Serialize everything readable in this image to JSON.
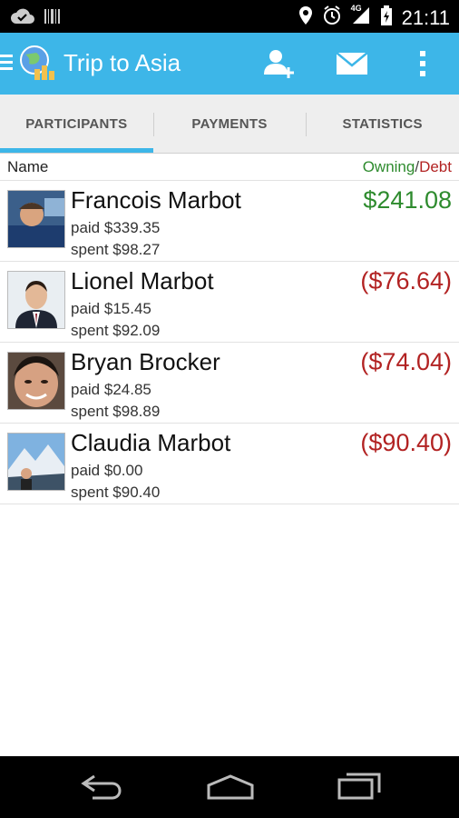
{
  "status_bar": {
    "time": "21:11",
    "signal_label": "4G"
  },
  "action_bar": {
    "title": "Trip to Asia",
    "icons": [
      "menu-icon",
      "globe-icon",
      "add-person-icon",
      "mail-icon",
      "overflow-menu-icon"
    ]
  },
  "tabs": [
    {
      "label": "PARTICIPANTS",
      "active": true
    },
    {
      "label": "PAYMENTS",
      "active": false
    },
    {
      "label": "STATISTICS",
      "active": false
    }
  ],
  "list_header": {
    "name": "Name",
    "owning": "Owning",
    "slash": "/",
    "debt": "Debt"
  },
  "participants": [
    {
      "name": "Francois Marbot",
      "paid": "paid  $339.35",
      "spent": "spent  $98.27",
      "balance": "$241.08",
      "status": "owning"
    },
    {
      "name": "Lionel Marbot",
      "paid": "paid  $15.45",
      "spent": "spent  $92.09",
      "balance": "($76.64)",
      "status": "debt"
    },
    {
      "name": "Bryan Brocker",
      "paid": "paid  $24.85",
      "spent": "spent  $98.89",
      "balance": "($74.04)",
      "status": "debt"
    },
    {
      "name": "Claudia Marbot",
      "paid": "paid  $0.00",
      "spent": "spent  $90.40",
      "balance": "($90.40)",
      "status": "debt"
    }
  ],
  "colors": {
    "action_bar": "#3db6e8",
    "owning": "#2e8b2e",
    "debt": "#b22222"
  }
}
